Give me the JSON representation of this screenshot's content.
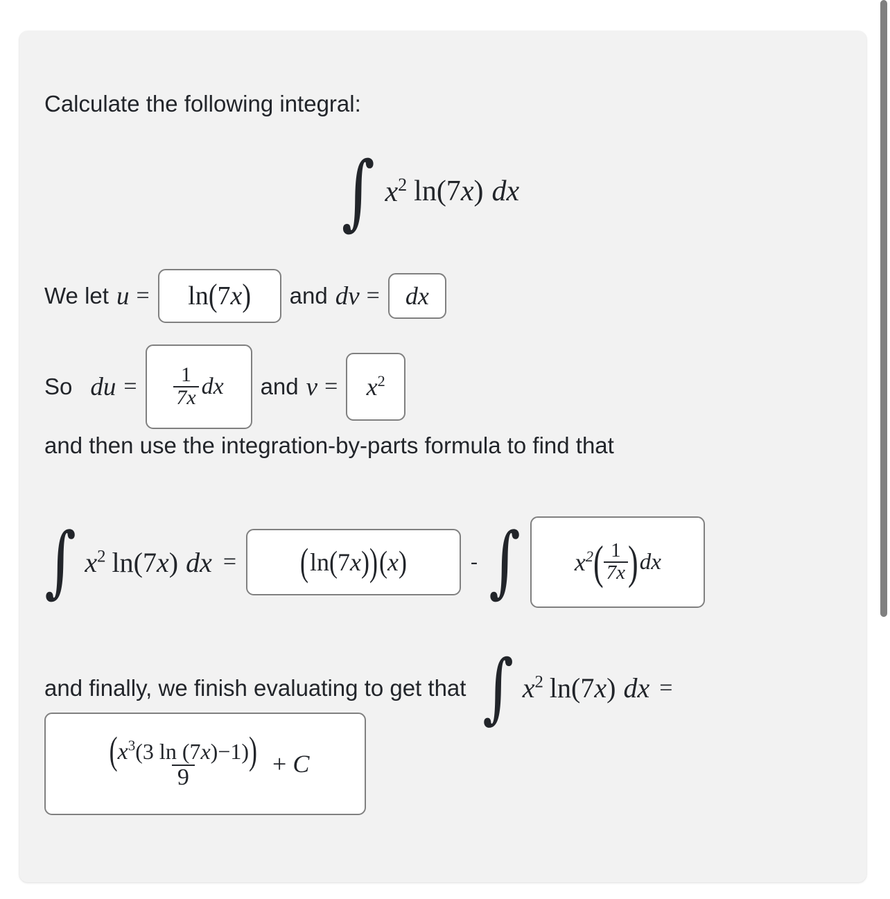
{
  "page": {
    "background": "#ffffff",
    "card_background": "#f2f2f2",
    "text_color": "#22252a",
    "box_border_color": "#808080",
    "box_fill": "#ffffff"
  },
  "scrollbar": {
    "thumb_color": "#808080",
    "track_color": "#ffffff"
  },
  "problem": {
    "prompt": "Calculate the following integral:",
    "integral": {
      "integral_sign": "∫",
      "integrand": "x² ln(7x)",
      "differential": "dx",
      "latex": "\\int x^2 \\ln(7x)\\,dx"
    }
  },
  "substitution_line": {
    "lead_text": "We let",
    "u_symbol": "u",
    "equals": "=",
    "u_value": "ln(7x)",
    "conjunction": "and",
    "dv_symbol": "dv",
    "dv_value": "dx"
  },
  "derivative_line": {
    "lead_text": "So",
    "du_symbol": "du",
    "equals": "=",
    "du_value": {
      "numerator": "1",
      "denominator": "7x",
      "suffix": "dx"
    },
    "conjunction": "and",
    "v_symbol": "v",
    "v_value": {
      "base": "x",
      "exponent": "2"
    }
  },
  "instruction": "and then use the integration-by-parts formula to find that",
  "parts_equation": {
    "lhs": "∫ x² ln(7x) dx",
    "equals": "=",
    "first_box": "(ln(7x))(x)",
    "minus": "-",
    "integral_sign": "∫",
    "second_box": {
      "base": "x",
      "exponent": "2",
      "fraction_numerator": "1",
      "fraction_denominator": "7x",
      "suffix": "dx"
    }
  },
  "final_line": {
    "text": "and finally, we finish evaluating to get that",
    "integral": "∫ x² ln(7x) dx",
    "equals": "="
  },
  "final_answer": {
    "numerator": "(x³(3 ln (7x)−1))",
    "numerator_parts": {
      "base": "x",
      "exponent": "3",
      "inner": "(3 ln (7x)−1)"
    },
    "denominator": "9",
    "constant": "+ C"
  }
}
